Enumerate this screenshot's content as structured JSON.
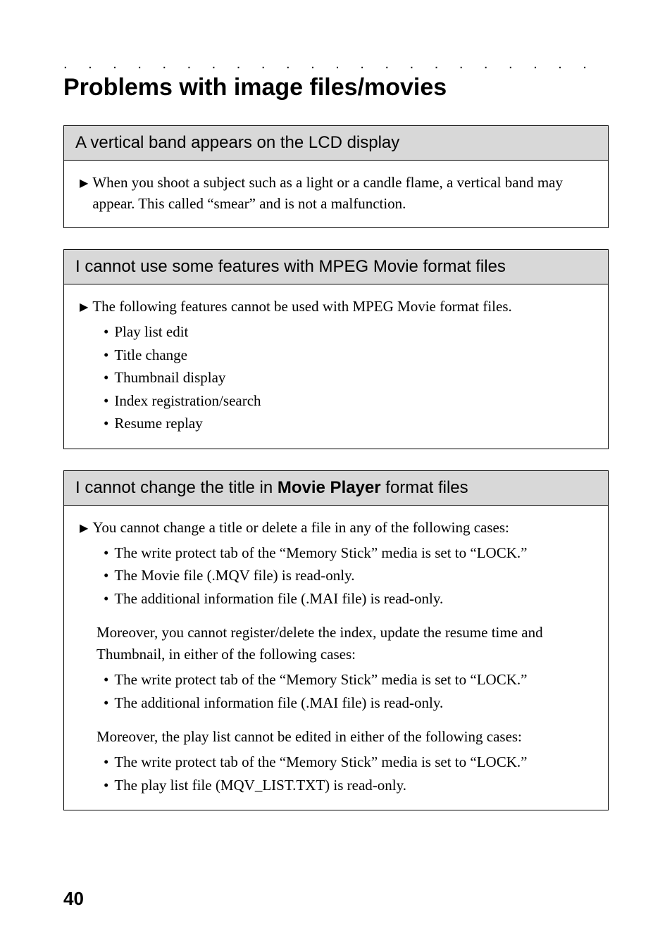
{
  "heading": "Problems with image files/movies",
  "dots": ". . . . . . . . . . . . . . . . . . . . . . . . . . . . . . . . . . . . . . . . . . . . .",
  "box1": {
    "header": "A vertical band appears on the LCD display",
    "arrow_text": "When you shoot a subject such as a light or a candle flame, a vertical band may appear. This called “smear” and is not a malfunction."
  },
  "box2": {
    "header": "I cannot use some features with MPEG Movie format files",
    "arrow_text": "The following features cannot be used with MPEG Movie format files.",
    "bullets": [
      "Play list edit",
      "Title change",
      "Thumbnail display",
      "Index registration/search",
      "Resume replay"
    ]
  },
  "box3": {
    "header_pre": "I cannot change the title in ",
    "header_bold": "Movie Player",
    "header_post": " format files",
    "arrow_text": "You cannot change a title or delete a file in any of the following cases:",
    "bullets1": [
      "The write protect tab of the “Memory Stick” media is set to “LOCK.”",
      "The Movie file (.MQV file) is read-only.",
      "The additional information file (.MAI file) is read-only."
    ],
    "para2": "Moreover, you cannot register/delete the index, update the resume time and Thumbnail, in either of the following cases:",
    "bullets2": [
      "The write protect tab of the “Memory Stick” media is set to “LOCK.”",
      "The additional information file (.MAI file) is read-only."
    ],
    "para3": "Moreover, the play list cannot be edited in either of the following cases:",
    "bullets3": [
      "The write protect tab of the “Memory Stick” media is set to “LOCK.”",
      "The play list file (MQV_LIST.TXT) is read-only."
    ]
  },
  "page_number": "40",
  "glyphs": {
    "arrow": "▶",
    "bullet": "•"
  }
}
